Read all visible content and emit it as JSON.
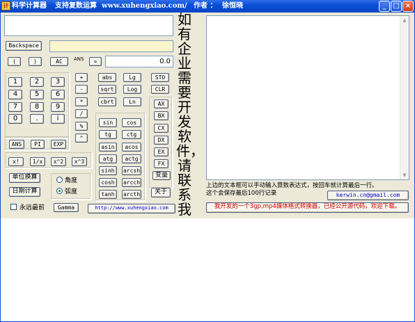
{
  "titlebar": {
    "icon_text": "计",
    "app_title": "科学计算器",
    "subtitle": "支持复数运算",
    "url": "www.xuhengxiao.com/",
    "author_label": "作者 ：",
    "author": "徐恒晓",
    "buttons": [
      "_",
      "□",
      "×"
    ]
  },
  "input": {
    "value": ""
  },
  "backspace_label": "Backspace",
  "status_field": "",
  "row_paren": {
    "open": "(",
    "close": ")",
    "ac": "AC",
    "ans_label": "ANS",
    "equals": "="
  },
  "result": {
    "value": "0.0"
  },
  "digits": [
    "1",
    "2",
    "3",
    "4",
    "5",
    "6",
    "7",
    "8",
    "9",
    "0",
    ".",
    "i"
  ],
  "operators": [
    "+",
    "-",
    "*",
    "/",
    "%",
    "^"
  ],
  "funcs_col1": [
    "abs",
    "sqrt",
    "cbrt"
  ],
  "funcs_col2": [
    "Lg",
    "Log",
    "Ln"
  ],
  "sto": "STO",
  "clr": "CLR",
  "registers": [
    "AX",
    "BX",
    "CX",
    "DX",
    "EX",
    "FX"
  ],
  "trig_col1": [
    "sin",
    "tg",
    "asin",
    "atg",
    "sinh",
    "cosh",
    "tanh"
  ],
  "trig_col2": [
    "cos",
    "ctg",
    "acos",
    "actg",
    "arcsh",
    "arcch",
    "arcth"
  ],
  "constants": [
    "ANS",
    "PI",
    "EXP"
  ],
  "powers": [
    "x!",
    "1/x",
    "x^2",
    "x^3"
  ],
  "unit_convert": "单位换算",
  "date_calc": "日期计算",
  "angle_options": [
    {
      "label": "角度",
      "selected": false
    },
    {
      "label": "弧度",
      "selected": true
    }
  ],
  "always_on_top": "永远最前",
  "gamma": "Gamma",
  "variables": "变量",
  "about": "关于",
  "website_link": "http://www.xuhengxiao.com",
  "ad_text": "如有企业需要开发软件，请联系我",
  "history": {
    "info_line1": "上边的文本框可以手动输入算数表达式，按回车就计算最后一行。",
    "info_line2": "这个会保存最后100行记录",
    "email": "kerwin.cn@gmail.com",
    "converter_note": "我开发的一个3gp,mp4媒体格式转换器，已经公开源代码，欢迎下载。"
  },
  "colors": {
    "titlebar": "#0a4fd6",
    "window_bg": "#ece9d8",
    "link": "#0000cc",
    "notice": "#d00000"
  }
}
